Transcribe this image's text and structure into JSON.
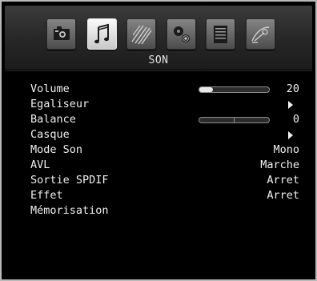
{
  "menu": {
    "title": "SON",
    "tabs": [
      {
        "icon": "picture-icon",
        "active": false
      },
      {
        "icon": "music-note-icon",
        "active": true
      },
      {
        "icon": "settings-stripes-icon",
        "active": false
      },
      {
        "icon": "gears-icon",
        "active": false
      },
      {
        "icon": "document-icon",
        "active": false
      },
      {
        "icon": "satellite-icon",
        "active": false
      }
    ],
    "items": [
      {
        "label": "Volume",
        "value": "20",
        "level": 0.2
      },
      {
        "label": "Egaliseur"
      },
      {
        "label": "Balance",
        "value": "0",
        "level": 0.5
      },
      {
        "label": "Casque"
      },
      {
        "label": "Mode Son",
        "value": "Mono"
      },
      {
        "label": "AVL",
        "value": "Marche"
      },
      {
        "label": "Sortie SPDIF",
        "value": "Arret"
      },
      {
        "label": "Effet",
        "value": "Arret"
      },
      {
        "label": "Mémorisation"
      }
    ]
  }
}
